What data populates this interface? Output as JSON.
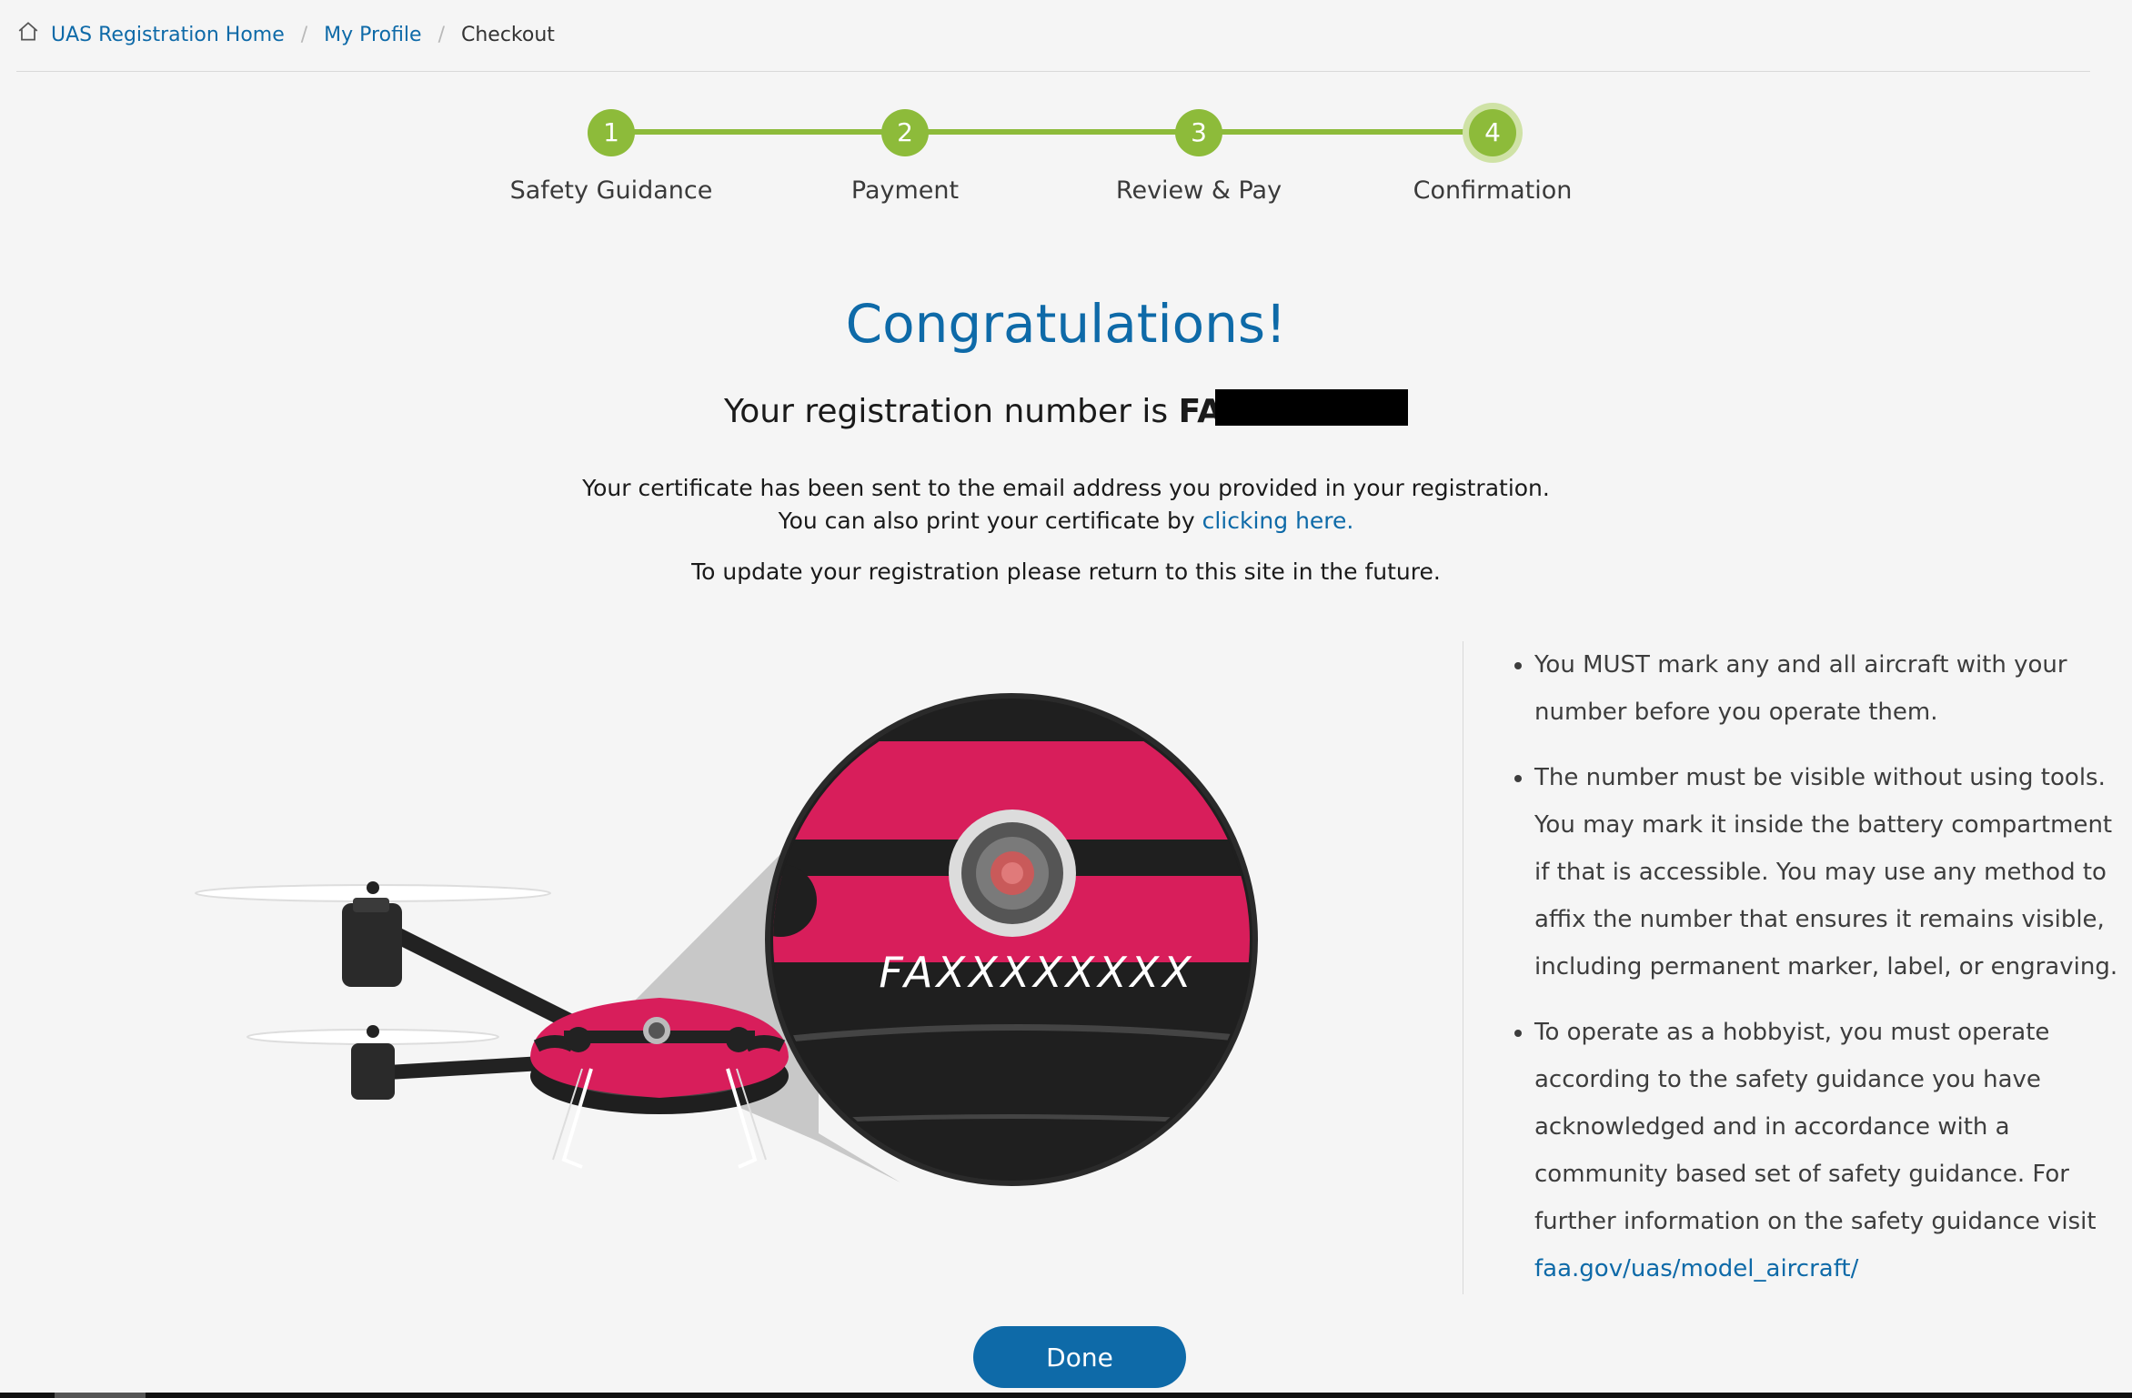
{
  "breadcrumb": {
    "home_label": "UAS Registration Home",
    "profile_label": "My Profile",
    "current_label": "Checkout",
    "separator": "/"
  },
  "stepper": {
    "accent_color": "#8dbb3a",
    "steps": [
      {
        "number": "1",
        "label": "Safety Guidance"
      },
      {
        "number": "2",
        "label": "Payment"
      },
      {
        "number": "3",
        "label": "Review & Pay"
      },
      {
        "number": "4",
        "label": "Confirmation"
      }
    ],
    "active_step": 4
  },
  "confirmation": {
    "title": "Congratulations!",
    "registration_prefix": "Your registration number is ",
    "registration_number_visible": "FA",
    "line1": "Your certificate has been sent to the email address you provided in your registration.",
    "line2_prefix": "You can also print your certificate by ",
    "line2_link": "clicking here.",
    "line3": "To update your registration please return to this site in the future."
  },
  "illustration": {
    "marking_text": "FAXXXXXXXX",
    "body_color": "#d81e5b"
  },
  "info": {
    "bullet1": "You MUST mark any and all aircraft with your number before you operate them.",
    "bullet2": "The number must be visible without using tools. You may mark it inside the battery compartment if that is accessible. You may use any method to affix the number that ensures it remains visible, including permanent marker, label, or engraving.",
    "bullet3": "To operate as a hobbyist, you must operate according to the safety guidance you have acknowledged and in accordance with a community based set of safety guidance. For further information on the safety guidance visit",
    "bullet3_link": "faa.gov/uas/model_aircraft/"
  },
  "actions": {
    "done_label": "Done"
  },
  "colors": {
    "link": "#0e6aa8",
    "background": "#f5f5f5"
  }
}
